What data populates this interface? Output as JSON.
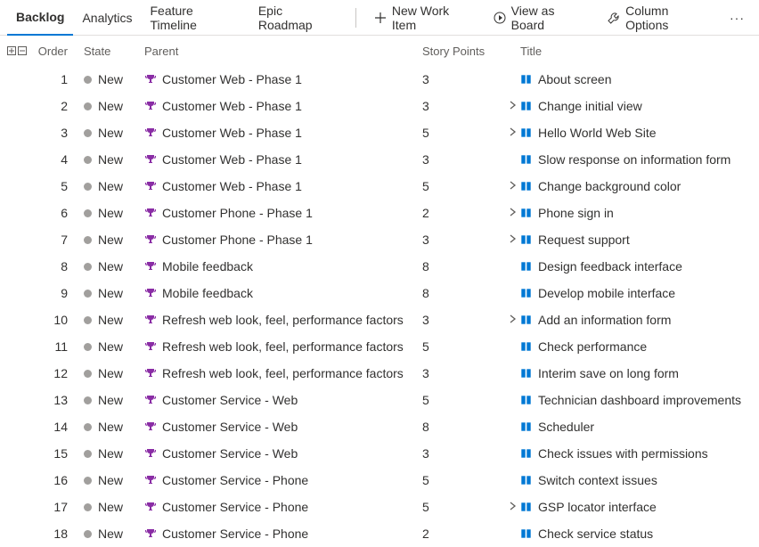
{
  "tabs": {
    "backlog": "Backlog",
    "analytics": "Analytics",
    "feature_timeline": "Feature Timeline",
    "epic_roadmap": "Epic Roadmap"
  },
  "tools": {
    "new_work_item": "New Work Item",
    "view_as_board": "View as Board",
    "column_options": "Column Options"
  },
  "columns": {
    "order": "Order",
    "state": "State",
    "parent": "Parent",
    "story_points": "Story Points",
    "title": "Title"
  },
  "state_label": "New",
  "rows": [
    {
      "order": "1",
      "parent": "Customer Web - Phase 1",
      "points": "3",
      "title": "About screen",
      "expandable": false
    },
    {
      "order": "2",
      "parent": "Customer Web - Phase 1",
      "points": "3",
      "title": "Change initial view",
      "expandable": true
    },
    {
      "order": "3",
      "parent": "Customer Web - Phase 1",
      "points": "5",
      "title": "Hello World Web Site",
      "expandable": true
    },
    {
      "order": "4",
      "parent": "Customer Web - Phase 1",
      "points": "3",
      "title": "Slow response on information form",
      "expandable": false
    },
    {
      "order": "5",
      "parent": "Customer Web - Phase 1",
      "points": "5",
      "title": "Change background color",
      "expandable": true
    },
    {
      "order": "6",
      "parent": "Customer Phone - Phase 1",
      "points": "2",
      "title": "Phone sign in",
      "expandable": true
    },
    {
      "order": "7",
      "parent": "Customer Phone - Phase 1",
      "points": "3",
      "title": "Request support",
      "expandable": true
    },
    {
      "order": "8",
      "parent": "Mobile feedback",
      "points": "8",
      "title": "Design feedback interface",
      "expandable": false
    },
    {
      "order": "9",
      "parent": "Mobile feedback",
      "points": "8",
      "title": "Develop mobile interface",
      "expandable": false
    },
    {
      "order": "10",
      "parent": "Refresh web look, feel, performance factors",
      "points": "3",
      "title": "Add an information form",
      "expandable": true
    },
    {
      "order": "11",
      "parent": "Refresh web look, feel, performance factors",
      "points": "5",
      "title": "Check performance",
      "expandable": false
    },
    {
      "order": "12",
      "parent": "Refresh web look, feel, performance factors",
      "points": "3",
      "title": "Interim save on long form",
      "expandable": false
    },
    {
      "order": "13",
      "parent": "Customer Service - Web",
      "points": "5",
      "title": "Technician dashboard improvements",
      "expandable": false
    },
    {
      "order": "14",
      "parent": "Customer Service - Web",
      "points": "8",
      "title": "Scheduler",
      "expandable": false
    },
    {
      "order": "15",
      "parent": "Customer Service - Web",
      "points": "3",
      "title": "Check issues with permissions",
      "expandable": false
    },
    {
      "order": "16",
      "parent": "Customer Service - Phone",
      "points": "5",
      "title": "Switch context issues",
      "expandable": false
    },
    {
      "order": "17",
      "parent": "Customer Service - Phone",
      "points": "5",
      "title": "GSP locator interface",
      "expandable": true
    },
    {
      "order": "18",
      "parent": "Customer Service - Phone",
      "points": "2",
      "title": "Check service status",
      "expandable": false
    }
  ]
}
